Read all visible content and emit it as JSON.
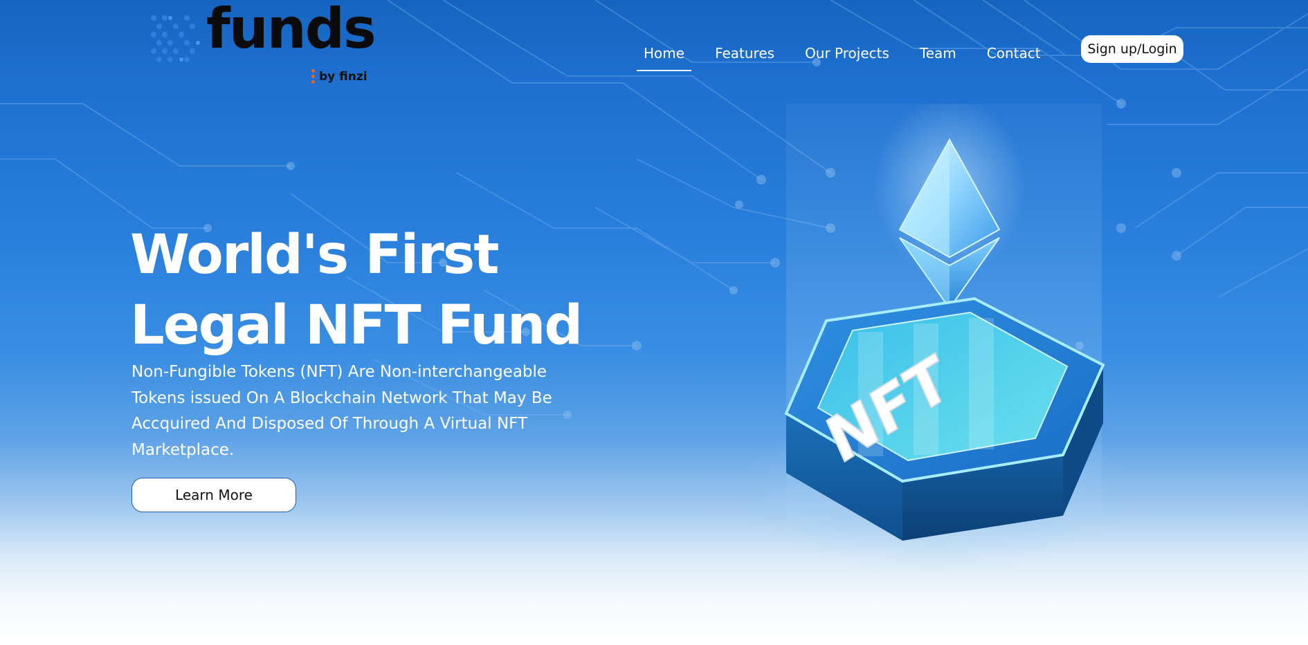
{
  "brand": {
    "name": "funds",
    "sub": "by finzi"
  },
  "nav": {
    "items": [
      {
        "label": "Home",
        "active": true
      },
      {
        "label": "Features",
        "active": false
      },
      {
        "label": "Our Projects",
        "active": false
      },
      {
        "label": "Team",
        "active": false
      },
      {
        "label": "Contact",
        "active": false
      }
    ],
    "signup_label": "Sign up/Login"
  },
  "hero": {
    "headline_line1": "World's First",
    "headline_line2": "Legal NFT Fund",
    "description": "Non-Fungible Tokens (NFT) Are Non-interchangeable Tokens issued On A Blockchain Network That May Be Accquired And Disposed Of Through A Virtual NFT Marketplace.",
    "cta_label": "Learn More"
  },
  "illustration": {
    "icon": "ethereum-icon",
    "badge_text": "NFT"
  },
  "colors": {
    "hero_blue": "#2a80dc",
    "deep_blue": "#1565c0",
    "cyan_glow": "#7fe6ff",
    "logo_dot_blue": "#2f7fe0",
    "logo_dot_orange": "#e8632b"
  }
}
